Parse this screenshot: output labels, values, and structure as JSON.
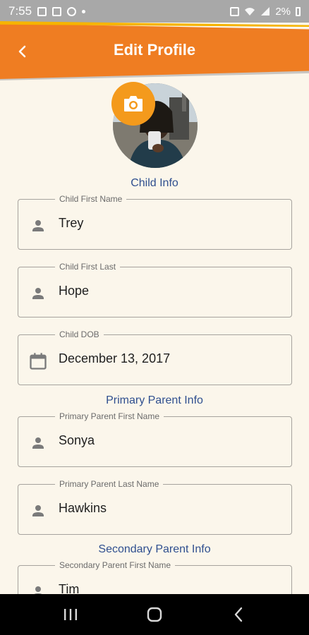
{
  "status": {
    "time": "7:55",
    "battery": "2%"
  },
  "header": {
    "title": "Edit Profile",
    "accent_color": "#ef7d22"
  },
  "avatar": {
    "camera_icon": "camera-icon"
  },
  "sections": {
    "child": "Child Info",
    "primary": "Primary Parent Info",
    "secondary": "Secondary Parent Info"
  },
  "fields": {
    "child_first": {
      "label": "Child First Name",
      "value": "Trey",
      "icon": "person-icon"
    },
    "child_last": {
      "label": "Child First Last",
      "value": "Hope",
      "icon": "person-icon"
    },
    "child_dob": {
      "label": "Child DOB",
      "value": "December 13, 2017",
      "icon": "calendar-icon"
    },
    "primary_first": {
      "label": "Primary Parent First Name",
      "value": "Sonya",
      "icon": "person-icon"
    },
    "primary_last": {
      "label": "Primary Parent Last Name",
      "value": "Hawkins",
      "icon": "person-icon"
    },
    "secondary_first": {
      "label": "Secondary Parent First Name",
      "value": "Tim",
      "icon": "person-icon"
    }
  },
  "nav": {
    "recents": "recents-icon",
    "home": "home-icon",
    "back": "back-icon"
  }
}
